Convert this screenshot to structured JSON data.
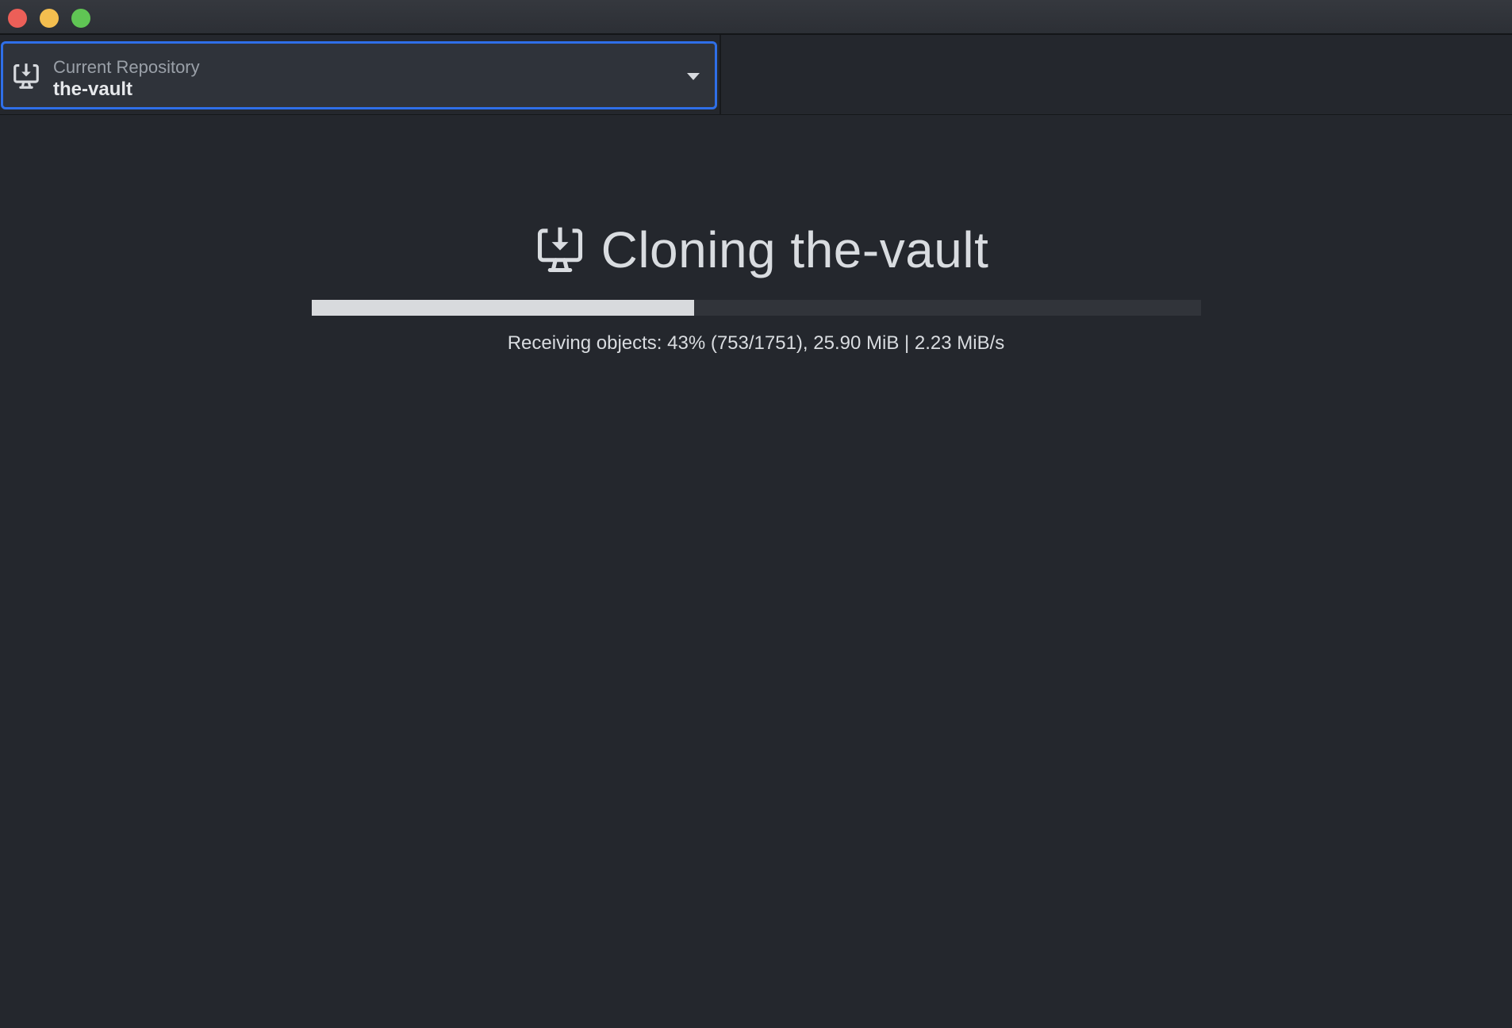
{
  "window": {
    "controls": [
      "close",
      "minimize",
      "zoom"
    ]
  },
  "toolbar": {
    "repository": {
      "caption": "Current Repository",
      "name": "the-vault",
      "icon": "repo-clone-icon",
      "dropdown_icon": "chevron-down-icon"
    }
  },
  "main": {
    "title": "Cloning the-vault",
    "icon": "repo-clone-icon",
    "progress": {
      "percent": 43,
      "text": "Receiving objects: 43% (753/1751), 25.90 MiB | 2.23 MiB/s"
    }
  },
  "colors": {
    "background": "#24272d",
    "accent": "#2f6fe8",
    "progress_fill": "#d8dadd",
    "progress_track": "#31343a",
    "traffic_close": "#ec5f58",
    "traffic_minimize": "#f4be4f",
    "traffic_zoom": "#60c554"
  }
}
